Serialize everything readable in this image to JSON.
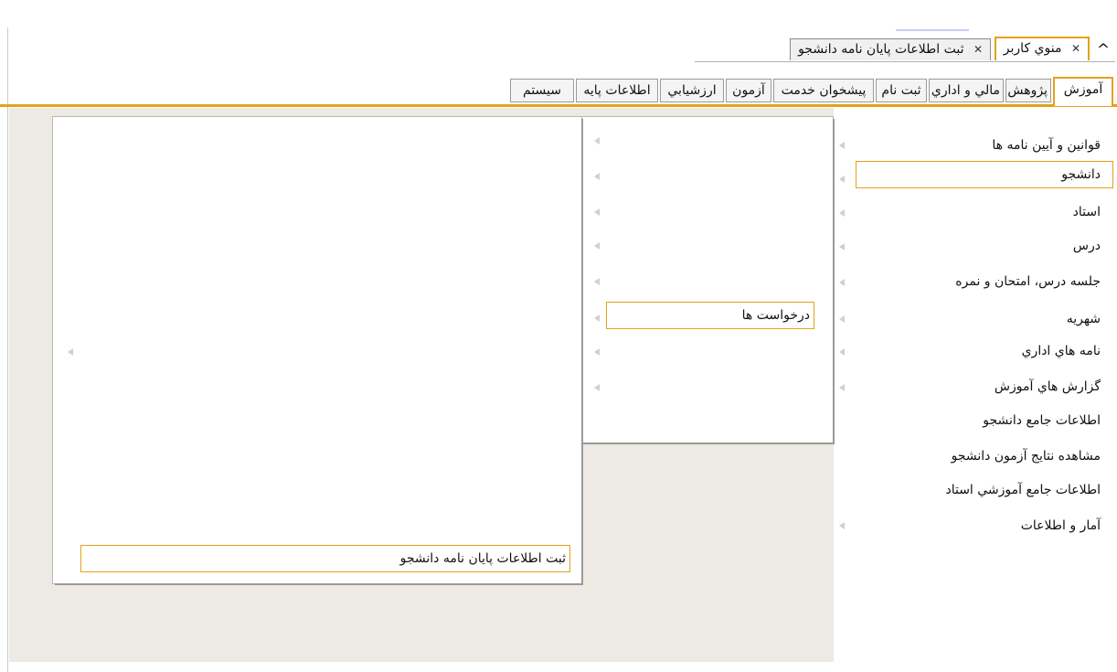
{
  "doc_tabs": [
    {
      "label": "منوي كاربر",
      "active": true
    },
    {
      "label": "ثبت اطلاعات پايان نامه دانشجو",
      "active": false
    }
  ],
  "categories": [
    "آموزش",
    "پژوهش",
    "مالي و اداري",
    "ثبت نام",
    "پيشخوان خدمت",
    "آزمون",
    "ارزشيابي",
    "اطلاعات پايه",
    "سيستم"
  ],
  "menu": {
    "col1": [
      "قوانين و آيين نامه ها",
      "دانشجو",
      "استاد",
      "درس",
      "جلسه درس، امتحان و نمره",
      "شهريه",
      "نامه هاي اداري",
      "گزارش هاي آموزش",
      "اطلاعات جامع دانشجو",
      "مشاهده نتايج آزمون دانشجو",
      "اطلاعات جامع آموزشي استاد",
      "آمار و اطلاعات"
    ],
    "col2_selected": "درخواست ها",
    "col3_selected": "ثبت اطلاعات پايان نامه دانشجو"
  },
  "colors": {
    "accent": "#e3a21a",
    "content_bg": "#eceae2",
    "panel_bg": "#ffffff"
  },
  "icons": {
    "home": "chevron-up-icon",
    "close": "close-icon",
    "submenu": "arrow-left-icon"
  }
}
